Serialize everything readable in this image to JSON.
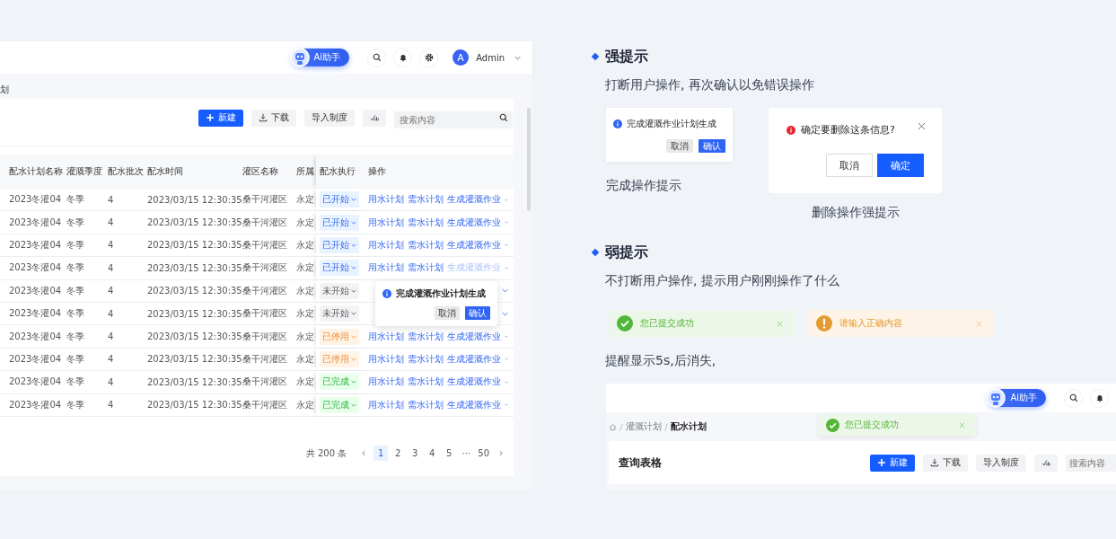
{
  "app": {
    "ai_button": "Ai助手",
    "user": {
      "avatar": "A",
      "name": "Admin"
    },
    "breadcrumb_fragment": "划",
    "toolbar": {
      "new": "新建",
      "download": "下载",
      "import": "导入制度",
      "search_placeholder": "搜索内容"
    },
    "table": {
      "columns": [
        "配水计划名称",
        "灌溉季度",
        "配水批次",
        "配水时间",
        "灌区名称",
        "所属",
        "配水执行",
        "操作"
      ],
      "rows": [
        {
          "name": "2023冬灌04",
          "season": "冬季",
          "batch": "4",
          "time": "2023/03/15  12:30:35",
          "area": "桑干河灌区",
          "unit": "永定",
          "status": {
            "kind": "started",
            "label": "已开始"
          },
          "actions": [
            {
              "label": "用水计划",
              "disabled": false
            },
            {
              "label": "需水计划",
              "disabled": false
            },
            {
              "label": "生成灌溉作业",
              "disabled": false
            }
          ]
        },
        {
          "name": "2023冬灌04",
          "season": "冬季",
          "batch": "4",
          "time": "2023/03/15  12:30:35",
          "area": "桑干河灌区",
          "unit": "永定",
          "status": {
            "kind": "started",
            "label": "已开始"
          },
          "actions": [
            {
              "label": "用水计划",
              "disabled": false
            },
            {
              "label": "需水计划",
              "disabled": false
            },
            {
              "label": "生成灌溉作业",
              "disabled": false
            }
          ]
        },
        {
          "name": "2023冬灌04",
          "season": "冬季",
          "batch": "4",
          "time": "2023/03/15  12:30:35",
          "area": "桑干河灌区",
          "unit": "永定",
          "status": {
            "kind": "started",
            "label": "已开始"
          },
          "actions": [
            {
              "label": "用水计划",
              "disabled": false
            },
            {
              "label": "需水计划",
              "disabled": false
            },
            {
              "label": "生成灌溉作业",
              "disabled": false
            }
          ]
        },
        {
          "name": "2023冬灌04",
          "season": "冬季",
          "batch": "4",
          "time": "2023/03/15  12:30:35",
          "area": "桑干河灌区",
          "unit": "永定",
          "status": {
            "kind": "started",
            "label": "已开始"
          },
          "actions": [
            {
              "label": "用水计划",
              "disabled": false
            },
            {
              "label": "需水计划",
              "disabled": false
            },
            {
              "label": "生成灌溉作业",
              "disabled": true
            }
          ]
        },
        {
          "name": "2023冬灌04",
          "season": "冬季",
          "batch": "4",
          "time": "2023/03/15  12:30:35",
          "area": "桑干河灌区",
          "unit": "永定",
          "status": {
            "kind": "pending",
            "label": "未开始"
          }
        },
        {
          "name": "2023冬灌04",
          "season": "冬季",
          "batch": "4",
          "time": "2023/03/15  12:30:35",
          "area": "桑干河灌区",
          "unit": "永定",
          "status": {
            "kind": "pending",
            "label": "未开始"
          }
        },
        {
          "name": "2023冬灌04",
          "season": "冬季",
          "batch": "4",
          "time": "2023/03/15  12:30:35",
          "area": "桑干河灌区",
          "unit": "永定",
          "status": {
            "kind": "stopped",
            "label": "已停用"
          },
          "actions": [
            {
              "label": "用水计划",
              "disabled": false
            },
            {
              "label": "需水计划",
              "disabled": false
            },
            {
              "label": "生成灌溉作业",
              "disabled": false
            }
          ]
        },
        {
          "name": "2023冬灌04",
          "season": "冬季",
          "batch": "4",
          "time": "2023/03/15  12:30:35",
          "area": "桑干河灌区",
          "unit": "永定",
          "status": {
            "kind": "stopped",
            "label": "已停用"
          },
          "actions": [
            {
              "label": "用水计划",
              "disabled": false
            },
            {
              "label": "需水计划",
              "disabled": false
            },
            {
              "label": "生成灌溉作业",
              "disabled": false
            }
          ]
        },
        {
          "name": "2023冬灌04",
          "season": "冬季",
          "batch": "4",
          "time": "2023/03/15  12:30:35",
          "area": "桑干河灌区",
          "unit": "永定",
          "status": {
            "kind": "done",
            "label": "已完成"
          },
          "actions": [
            {
              "label": "用水计划",
              "disabled": false
            },
            {
              "label": "需水计划",
              "disabled": false
            },
            {
              "label": "生成灌溉作业",
              "disabled": false
            }
          ]
        },
        {
          "name": "2023冬灌04",
          "season": "冬季",
          "batch": "4",
          "time": "2023/03/15  12:30:35",
          "area": "桑干河灌区",
          "unit": "永定",
          "status": {
            "kind": "done",
            "label": "已完成"
          },
          "actions": [
            {
              "label": "用水计划",
              "disabled": false
            },
            {
              "label": "需水计划",
              "disabled": false
            },
            {
              "label": "生成灌溉作业",
              "disabled": false
            }
          ]
        }
      ]
    },
    "popover": {
      "message": "完成灌溉作业计划生成",
      "cancel": "取消",
      "confirm": "确认"
    },
    "pagination": {
      "total": "共 200 条",
      "pages": [
        {
          "label": "1",
          "selected": true
        },
        {
          "label": "2",
          "selected": false
        },
        {
          "label": "3",
          "selected": false
        },
        {
          "label": "4",
          "selected": false
        },
        {
          "label": "5",
          "selected": false
        },
        {
          "label": "···",
          "selected": false
        },
        {
          "label": "50",
          "selected": false
        }
      ]
    }
  },
  "strong": {
    "title": "强提示",
    "description": "打断用户操作, 再次确认以免错误操作",
    "popconfirm": {
      "message": "完成灌溉作业计划生成",
      "cancel": "取消",
      "confirm": "确认",
      "caption": "完成操作提示"
    },
    "modal": {
      "message": "确定要删除这条信息?",
      "cancel": "取消",
      "confirm": "确定",
      "caption": "删除操作强提示"
    }
  },
  "weak": {
    "title": "弱提示",
    "description": "不打断用户操作, 提示用户刚刚操作了什么",
    "toasts": [
      {
        "kind": "success",
        "message": "您已提交成功"
      },
      {
        "kind": "warning",
        "message": "请输入正确内容"
      }
    ],
    "note": "提醒显示5s,后消失,",
    "preview": {
      "ai_button": "Ai助手",
      "breadcrumb": [
        "灌溉计划",
        "配水计划"
      ],
      "toast": {
        "kind": "success",
        "message": "您已提交成功"
      },
      "title": "查询表格",
      "new": "新建",
      "download": "下载",
      "import": "导入制度",
      "search_placeholder": "搜索内容"
    }
  }
}
